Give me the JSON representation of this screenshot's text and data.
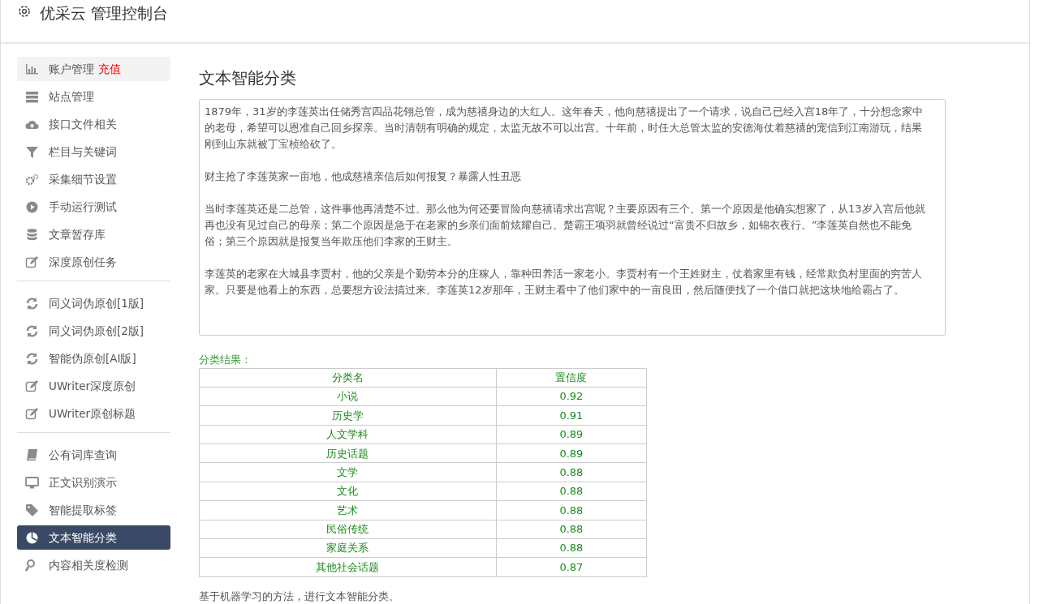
{
  "header": {
    "title": "优采云 管理控制台"
  },
  "sidebar": {
    "groups": [
      {
        "items": [
          {
            "label": "账户管理",
            "tag": "充值",
            "selected": false,
            "hover": true
          },
          {
            "label": "站点管理",
            "selected": false
          },
          {
            "label": "接口文件相关",
            "selected": false
          },
          {
            "label": "栏目与关键词",
            "selected": false
          },
          {
            "label": "采集细节设置",
            "selected": false
          },
          {
            "label": "手动运行测试",
            "selected": false
          },
          {
            "label": "文章暂存库",
            "selected": false
          },
          {
            "label": "深度原创任务",
            "selected": false
          }
        ]
      },
      {
        "items": [
          {
            "label": "同义词伪原创[1版]",
            "selected": false
          },
          {
            "label": "同义词伪原创[2版]",
            "selected": false
          },
          {
            "label": "智能伪原创[AI版]",
            "selected": false
          },
          {
            "label": "UWriter深度原创",
            "selected": false
          },
          {
            "label": "UWriter原创标题",
            "selected": false
          }
        ]
      },
      {
        "items": [
          {
            "label": "公有词库查询",
            "selected": false
          },
          {
            "label": "正文识别演示",
            "selected": false
          },
          {
            "label": "智能提取标签",
            "selected": false
          },
          {
            "label": "文本智能分类",
            "selected": true
          },
          {
            "label": "内容相关度检测",
            "selected": false
          }
        ]
      }
    ]
  },
  "main": {
    "title": "文本智能分类",
    "input_paragraphs": [
      "1879年，31岁的李莲英出任储秀宫四品花翎总管，成为慈禧身边的大红人。这年春天，他向慈禧提出了一个请求，说自己已经入宫18年了，十分想念家中的老母，希望可以恩准自己回乡探亲。当时清朝有明确的规定，太监无故不可以出宫。十年前，时任大总管太监的安德海仗着慈禧的宠信到江南游玩，结果刚到山东就被丁宝桢给砍了。",
      "财主抢了李莲英家一亩地，他成慈禧亲信后如何报复？暴露人性丑恶",
      "当时李莲英还是二总管，这件事他再清楚不过。那么他为何还要冒险向慈禧请求出宫呢？主要原因有三个。第一个原因是他确实想家了，从13岁入宫后他就再也没有见过自己的母亲；第二个原因是急于在老家的乡亲们面前炫耀自己。楚霸王项羽就曾经说过“富贵不归故乡，如锦衣夜行。”李莲英自然也不能免俗；第三个原因就是报复当年欺压他们李家的王财主。",
      "李莲英的老家在大城县李贾村，他的父亲是个勤劳本分的庄稼人，靠种田养活一家老小。李贾村有一个王姓财主，仗着家里有钱，经常欺负村里面的穷苦人家。只要是他看上的东西，总要想方设法搞过来。李莲英12岁那年，王财主看中了他们家中的一亩良田，然后随便找了一个借口就把这块地给霸占了。"
    ],
    "result_label": "分类结果：",
    "table": {
      "columns": [
        "分类名",
        "置信度"
      ],
      "rows": [
        [
          "小说",
          "0.92"
        ],
        [
          "历史学",
          "0.91"
        ],
        [
          "人文学科",
          "0.89"
        ],
        [
          "历史话题",
          "0.89"
        ],
        [
          "文学",
          "0.88"
        ],
        [
          "文化",
          "0.88"
        ],
        [
          "艺术",
          "0.88"
        ],
        [
          "民俗传统",
          "0.88"
        ],
        [
          "家庭关系",
          "0.88"
        ],
        [
          "其他社会话题",
          "0.87"
        ]
      ]
    },
    "note": "基于机器学习的方法，进行文本智能分类。"
  }
}
